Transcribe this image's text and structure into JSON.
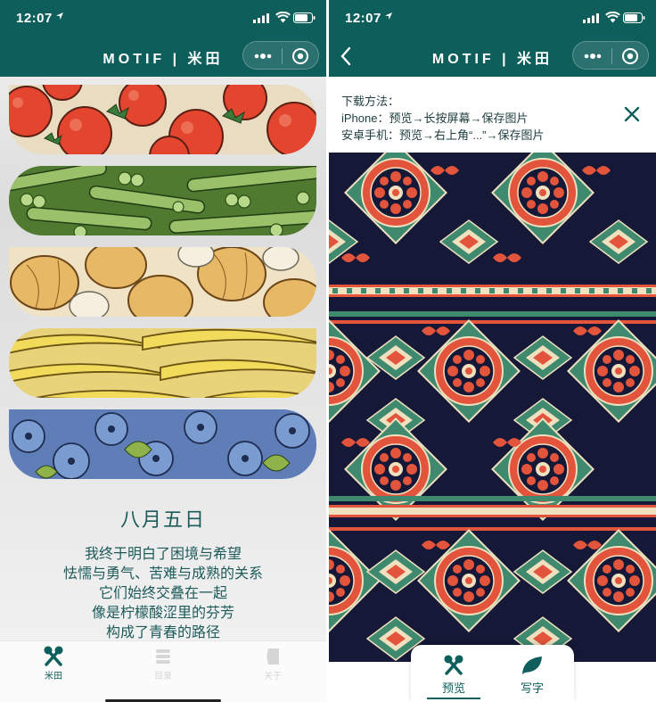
{
  "left": {
    "status": {
      "time": "12:07"
    },
    "nav": {
      "title": "MOTIF | 米田"
    },
    "bands": [
      {
        "name": "tomatoes",
        "icon": "tomato-pattern"
      },
      {
        "name": "peas",
        "icon": "pea-pattern"
      },
      {
        "name": "onions",
        "icon": "onion-pattern"
      },
      {
        "name": "bananas",
        "icon": "banana-pattern"
      },
      {
        "name": "blueberries",
        "icon": "blueberry-pattern"
      }
    ],
    "poem": {
      "title": "八月五日",
      "lines": [
        "我终于明白了困境与希望",
        "怯懦与勇气、苦难与成熟的关系",
        "它们始终交叠在一起",
        "像是柠檬酸涩里的芬芳",
        "构成了青春的路径"
      ]
    },
    "tabbar": {
      "tabs": [
        {
          "label": "米田",
          "icon": "utensils-icon",
          "active": true
        },
        {
          "label": "目录",
          "icon": "list-icon",
          "active": false
        },
        {
          "label": "关于",
          "icon": "about-icon",
          "active": false
        }
      ]
    }
  },
  "right": {
    "status": {
      "time": "12:07"
    },
    "nav": {
      "title": "MOTIF | 米田"
    },
    "download": {
      "heading": "下载方法：",
      "iphone": "iPhone：预览→长按屏幕→保存图片",
      "android": "安卓手机：预览→右上角“...”→保存图片"
    },
    "float_tabs": [
      {
        "label": "预览",
        "icon": "utensils-icon",
        "selected": true
      },
      {
        "label": "写字",
        "icon": "leaf-icon",
        "selected": false
      }
    ]
  },
  "colors": {
    "brand": "#0e5e5c",
    "pattern_bg": "#151836",
    "pattern_red": "#e2553c",
    "pattern_green": "#3f8a6f",
    "pattern_cream": "#efe0c0"
  }
}
